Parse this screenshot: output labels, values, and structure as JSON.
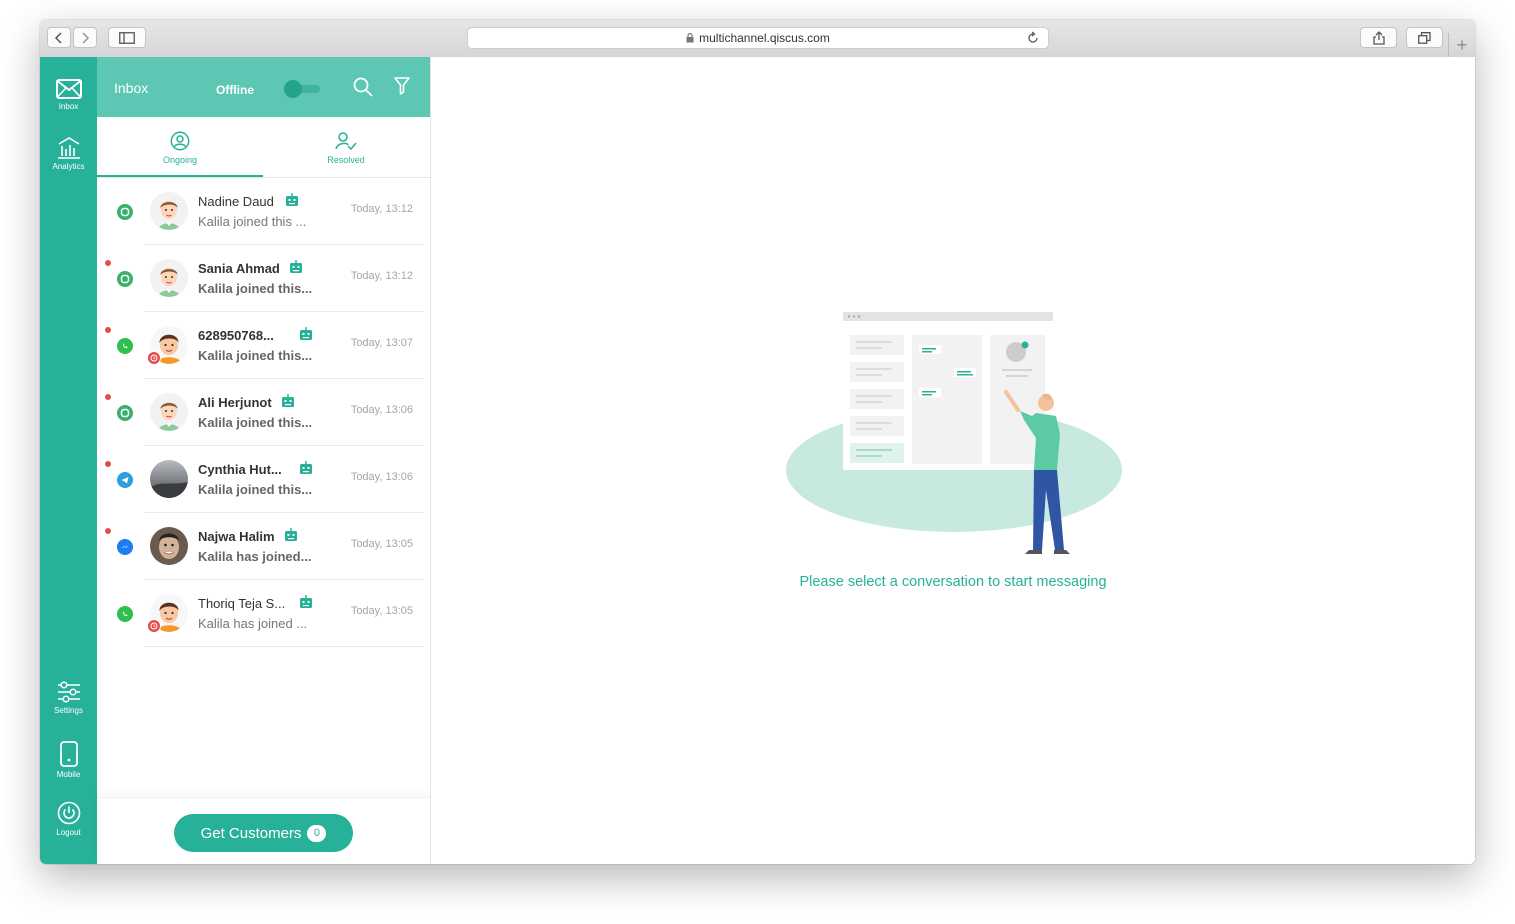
{
  "browser": {
    "url": "multichannel.qiscus.com"
  },
  "nav": {
    "items": [
      {
        "label": "Inbox",
        "icon": "mail-icon"
      },
      {
        "label": "Analytics",
        "icon": "bank-chart-icon"
      },
      {
        "label": "Settings",
        "icon": "sliders-icon"
      },
      {
        "label": "Mobile",
        "icon": "mobile-icon"
      },
      {
        "label": "Logout",
        "icon": "power-icon"
      }
    ]
  },
  "panel": {
    "title": "Inbox",
    "status": "Offline",
    "tabs": [
      {
        "label": "Ongoing",
        "active": true
      },
      {
        "label": "Resolved",
        "active": false
      }
    ],
    "conversations": [
      {
        "name": "Nadine Daud",
        "message": "Kalila joined this ...",
        "time": "Today, 13:12",
        "channel": "qiscus",
        "unread": false,
        "bold": false,
        "avatar": "cartoon-green"
      },
      {
        "name": "Sania Ahmad",
        "message": "Kalila joined this...",
        "time": "Today, 13:12",
        "channel": "qiscus",
        "unread": true,
        "bold": true,
        "avatar": "cartoon-green"
      },
      {
        "name": "628950768...",
        "message": "Kalila joined this...",
        "time": "Today, 13:07",
        "channel": "whatsapp",
        "unread": true,
        "bold": true,
        "avatar": "cartoon-orange"
      },
      {
        "name": "Ali Herjunot",
        "message": "Kalila joined this...",
        "time": "Today, 13:06",
        "channel": "qiscus",
        "unread": true,
        "bold": true,
        "avatar": "cartoon-green"
      },
      {
        "name": "Cynthia Hut...",
        "message": "Kalila joined this...",
        "time": "Today, 13:06",
        "channel": "telegram",
        "unread": true,
        "bold": true,
        "avatar": "photo-gray"
      },
      {
        "name": "Najwa Halim",
        "message": "Kalila has joined...",
        "time": "Today, 13:05",
        "channel": "messenger",
        "unread": true,
        "bold": true,
        "avatar": "photo-face"
      },
      {
        "name": "Thoriq Teja S...",
        "message": "Kalila has joined ...",
        "time": "Today, 13:05",
        "channel": "whatsapp",
        "unread": false,
        "bold": false,
        "avatar": "cartoon-orange"
      }
    ],
    "get_customers_label": "Get Customers",
    "get_customers_count": "0"
  },
  "main": {
    "empty_message": "Please select a conversation to start messaging"
  },
  "colors": {
    "primary": "#27b199",
    "header": "#5cc7b2",
    "unread": "#e34c4c"
  }
}
